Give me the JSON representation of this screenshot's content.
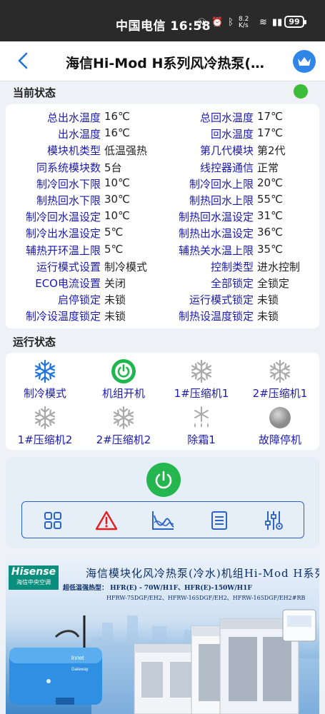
{
  "statusbar": {
    "carrier": "中国电信",
    "time": "16:58",
    "net_speed": "8.2 K/s",
    "battery": "99"
  },
  "header": {
    "title": "海信Hi-Mod H系列风冷热泵(…"
  },
  "current_status": {
    "label": "当前状态",
    "indicator_color": "#3dbb39",
    "rows": [
      {
        "l1": "总出水温度",
        "v1": "16℃",
        "l2": "总回水温度",
        "v2": "17℃"
      },
      {
        "l1": "出水温度",
        "v1": "16℃",
        "l2": "回水温度",
        "v2": "17℃"
      },
      {
        "l1": "模块机类型",
        "v1": "低温强热",
        "l2": "第几代模块",
        "v2": "第2代"
      },
      {
        "l1": "同系统模块数",
        "v1": "5台",
        "l2": "线控器通信",
        "v2": "正常"
      },
      {
        "l1": "制冷回水下限",
        "v1": "10℃",
        "l2": "制冷回水上限",
        "v2": "20℃"
      },
      {
        "l1": "制热回水下限",
        "v1": "30℃",
        "l2": "制热回水上限",
        "v2": "55℃"
      },
      {
        "l1": "制冷回水温设定",
        "v1": "10℃",
        "l2": "制热回水温设定",
        "v2": "31℃"
      },
      {
        "l1": "制冷出水温设定",
        "v1": "5℃",
        "l2": "制热出水温设定",
        "v2": "36℃"
      },
      {
        "l1": "辅热开环温上限",
        "v1": "5℃",
        "l2": "辅热关水温上限",
        "v2": "35℃"
      },
      {
        "l1": "运行模式设置",
        "v1": "制冷模式",
        "l2": "控制类型",
        "v2": "进水控制"
      },
      {
        "l1": "ECO电流设置",
        "v1": "关闭",
        "l2": "全部锁定",
        "v2": "全锁定"
      },
      {
        "l1": "启停锁定",
        "v1": "未锁",
        "l2": "运行模式锁定",
        "v2": "未锁"
      },
      {
        "l1": "制冷设温度锁定",
        "v1": "未锁",
        "l2": "制热设温度锁定",
        "v2": "未锁"
      }
    ]
  },
  "run_status": {
    "label": "运行状态",
    "items": [
      {
        "label": "制冷模式",
        "icon": "snowflake-icon",
        "state": "active-blue"
      },
      {
        "label": "机组开机",
        "icon": "power-icon",
        "state": "active-green"
      },
      {
        "label": "1#压缩机1",
        "icon": "snowflake-icon",
        "state": "inactive"
      },
      {
        "label": "2#压缩机1",
        "icon": "snowflake-icon",
        "state": "inactive"
      },
      {
        "label": "1#压缩机2",
        "icon": "snowflake-icon",
        "state": "inactive"
      },
      {
        "label": "2#压缩机2",
        "icon": "snowflake-icon",
        "state": "inactive"
      },
      {
        "label": "除霜1",
        "icon": "defrost-icon",
        "state": "inactive"
      },
      {
        "label": "故障停机",
        "icon": "fault-dot-icon",
        "state": "inactive"
      }
    ]
  },
  "controls": {
    "power_color": "#26b650",
    "tools": [
      "grid-icon",
      "warning-icon",
      "chart-icon",
      "list-icon",
      "sliders-icon"
    ]
  },
  "banner": {
    "brand": "Hisense",
    "brand_sub": "海信中央空调",
    "title": "海信模块化风冷热泵(冷水)机组Hi-Mod H系列",
    "sub1": "超低温强热型： HFR(E) - 70W/H1F、HFR(E)-150W/H1F",
    "sub2": "HFRW-75DGF/EH2、HFRW-165DGF/EH2、HFRW-165DGF/EH2#RB"
  }
}
